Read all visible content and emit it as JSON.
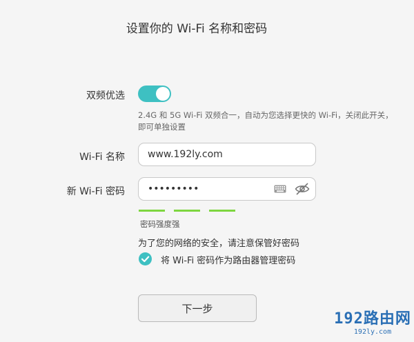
{
  "page": {
    "title": "设置你的 Wi-Fi 名称和密码"
  },
  "dual_band": {
    "label": "双频优选",
    "enabled": true,
    "hint": "2.4G 和 5G Wi-Fi 双频合一，自动为您选择更快的 Wi-Fi，关闭此开关，即可单独设置"
  },
  "wifi_name": {
    "label": "Wi-Fi 名称",
    "value": "www.192ly.com"
  },
  "wifi_password": {
    "label": "新 Wi-Fi 密码",
    "value": "•••••••••",
    "keyboard_icon": "keyboard-icon",
    "visibility_icon": "eye-hidden-icon"
  },
  "strength": {
    "level": 3,
    "max": 3,
    "label": "密码强度强",
    "color": "#7ed63f"
  },
  "notice": "为了您的网络的安全，请注意保管好密码",
  "admin_password_option": {
    "checked": true,
    "label": "将 Wi-Fi 密码作为路由器管理密码"
  },
  "next_button": {
    "label": "下一步"
  },
  "watermark": {
    "main": "192路由网",
    "sub": "192ly.com"
  },
  "colors": {
    "accent": "#3ec0c2",
    "strength": "#7ed63f",
    "watermark": "#2a6fb5"
  }
}
